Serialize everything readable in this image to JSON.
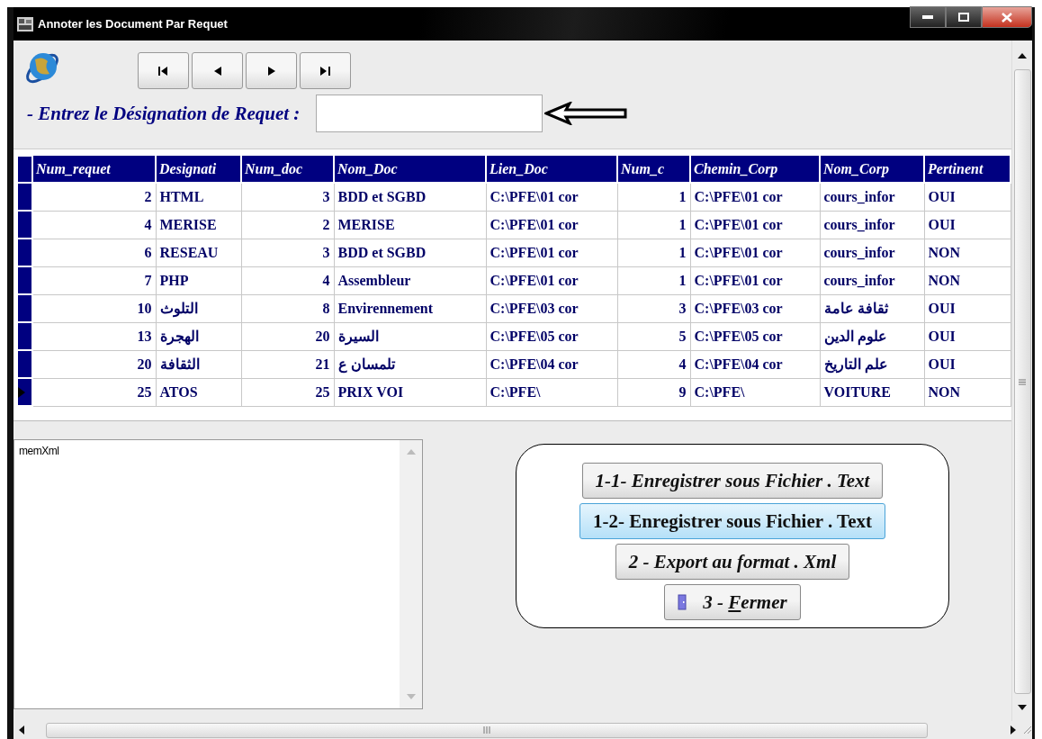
{
  "window": {
    "title": "Annoter les Document Par Requet"
  },
  "navigator": {
    "buttons": [
      {
        "kind": "first"
      },
      {
        "kind": "prev"
      },
      {
        "kind": "next"
      },
      {
        "kind": "last"
      }
    ]
  },
  "query": {
    "label": "- Entrez le Désignation de Requet :"
  },
  "table": {
    "columns": [
      {
        "label": "Num_requet",
        "kind": "number"
      },
      {
        "label": "Designati",
        "kind": "text"
      },
      {
        "label": "Num_doc",
        "kind": "number"
      },
      {
        "label": "Nom_Doc",
        "kind": "text"
      },
      {
        "label": "Lien_Doc",
        "kind": "text"
      },
      {
        "label": "Num_c",
        "kind": "number"
      },
      {
        "label": "Chemin_Corp",
        "kind": "text"
      },
      {
        "label": "Nom_Corp",
        "kind": "text"
      },
      {
        "label": "Pertinent",
        "kind": "text"
      }
    ],
    "rows": [
      {
        "current": false,
        "cells": [
          "2",
          "HTML",
          "3",
          "BDD et SGBD",
          "C:\\PFE\\01 cor",
          "1",
          "C:\\PFE\\01 cor",
          "cours_infor",
          "OUI"
        ]
      },
      {
        "current": false,
        "cells": [
          "4",
          "MERISE",
          "2",
          "MERISE",
          "C:\\PFE\\01 cor",
          "1",
          "C:\\PFE\\01 cor",
          "cours_infor",
          "OUI"
        ]
      },
      {
        "current": false,
        "cells": [
          "6",
          "RESEAU",
          "3",
          "BDD et SGBD",
          "C:\\PFE\\01 cor",
          "1",
          "C:\\PFE\\01 cor",
          "cours_infor",
          "NON"
        ]
      },
      {
        "current": false,
        "cells": [
          "7",
          "PHP",
          "4",
          "Assembleur",
          "C:\\PFE\\01 cor",
          "1",
          "C:\\PFE\\01 cor",
          "cours_infor",
          "NON"
        ]
      },
      {
        "current": false,
        "cells": [
          "10",
          "التلوث",
          "8",
          "Envirennement",
          "C:\\PFE\\03 cor",
          "3",
          "C:\\PFE\\03 cor",
          "ثقافة عامة",
          "OUI"
        ]
      },
      {
        "current": false,
        "cells": [
          "13",
          "الهجرة",
          "20",
          "السيرة",
          "C:\\PFE\\05 cor",
          "5",
          "C:\\PFE\\05 cor",
          "علوم الدين",
          "OUI"
        ]
      },
      {
        "current": false,
        "cells": [
          "20",
          "الثقافة",
          "21",
          "تلمسان ع",
          "C:\\PFE\\04 cor",
          "4",
          "C:\\PFE\\04 cor",
          "علم التاريخ",
          "OUI"
        ]
      },
      {
        "current": true,
        "cells": [
          "25",
          "ATOS",
          "25",
          "PRIX VOI",
          "C:\\PFE\\",
          "9",
          "C:\\PFE\\",
          "VOITURE",
          "NON"
        ]
      }
    ]
  },
  "memo": {
    "text": "memXml"
  },
  "actions": [
    {
      "kind": "plain",
      "focused": false,
      "label": "1-1- Enregistrer sous Fichier . Text"
    },
    {
      "kind": "plain",
      "focused": true,
      "label": "1-2- Enregistrer sous Fichier . Text"
    },
    {
      "kind": "plain",
      "focused": false,
      "label": "2 - Export au format . Xml"
    },
    {
      "kind": "door",
      "focused": false,
      "label_before": "3 - ",
      "accelerator": "F",
      "label_after": "ermer"
    }
  ]
}
